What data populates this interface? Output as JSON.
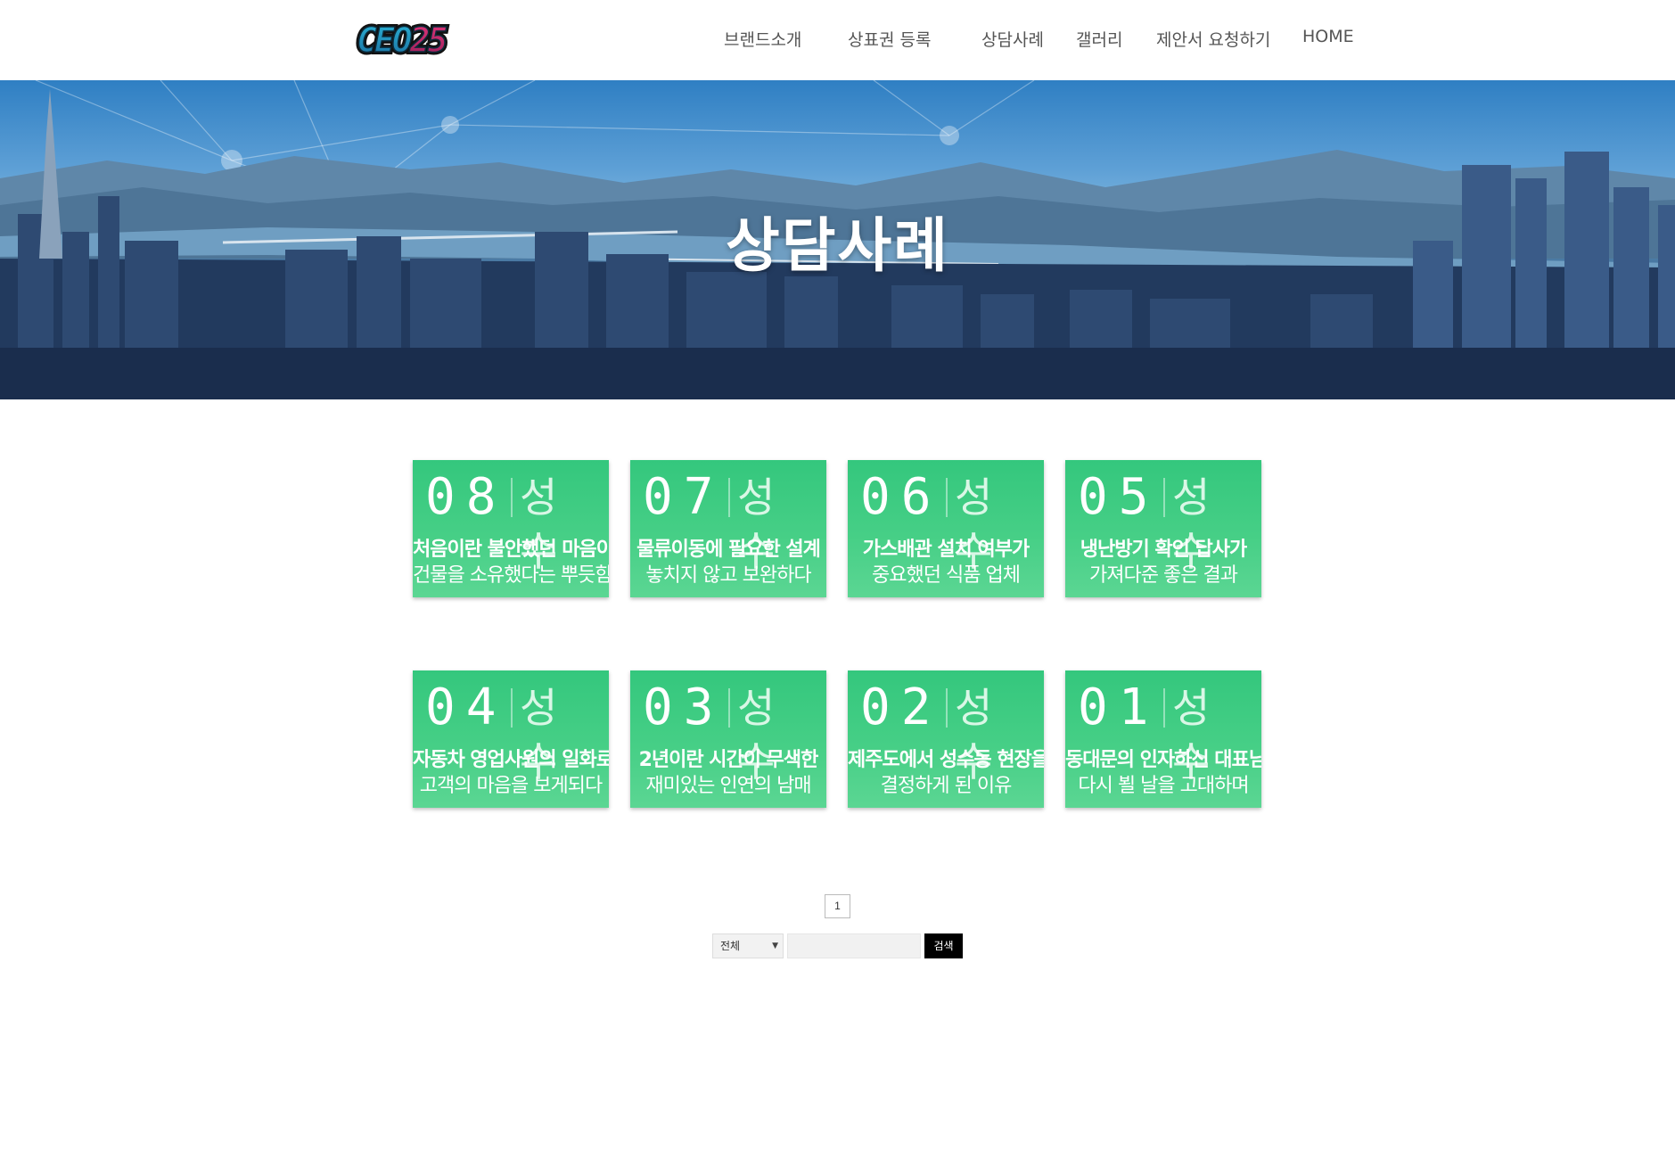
{
  "header": {
    "logo_text": "CEO25",
    "nav": [
      {
        "label": "브랜드소개"
      },
      {
        "label": "상표권 등록"
      },
      {
        "label": "상담사례"
      },
      {
        "label": "갤러리"
      },
      {
        "label": "제안서 요청하기"
      },
      {
        "label": "HOME"
      }
    ]
  },
  "hero": {
    "title": "상담사례"
  },
  "cards": [
    {
      "number": "08",
      "tag": "성수",
      "line1": "처음이란 불안했던 마음이",
      "line2": "건물을 소유했다는 뿌듯함으로"
    },
    {
      "number": "07",
      "tag": "성수",
      "line1": "물류이동에 필요한 설계",
      "line2": "놓치지 않고 보완하다"
    },
    {
      "number": "06",
      "tag": "성수",
      "line1": "가스배관 설치 여부가",
      "line2": "중요했던 식품 업체"
    },
    {
      "number": "05",
      "tag": "성수",
      "line1": "냉난방기 확인 답사가",
      "line2": "가져다준 좋은 결과"
    },
    {
      "number": "04",
      "tag": "성수",
      "line1": "자동차 영업사원의 일화로",
      "line2": "고객의 마음을 보게되다"
    },
    {
      "number": "03",
      "tag": "성수",
      "line1": "2년이란 시간이 무색한",
      "line2": "재미있는 인연의 남매"
    },
    {
      "number": "02",
      "tag": "성수",
      "line1": "제주도에서 성수동 현장을",
      "line2": "결정하게 된 이유"
    },
    {
      "number": "01",
      "tag": "성수",
      "line1": "동대문의 인자하신 대표님",
      "line2": "다시 뵐 날을 고대하며"
    }
  ],
  "pagination": {
    "current_page": "1"
  },
  "search": {
    "select_value": "전체",
    "input_value": "",
    "button_label": "검색"
  },
  "colors": {
    "card_green": "#3fcb82",
    "nav_text": "#555555",
    "search_button": "#000000"
  }
}
